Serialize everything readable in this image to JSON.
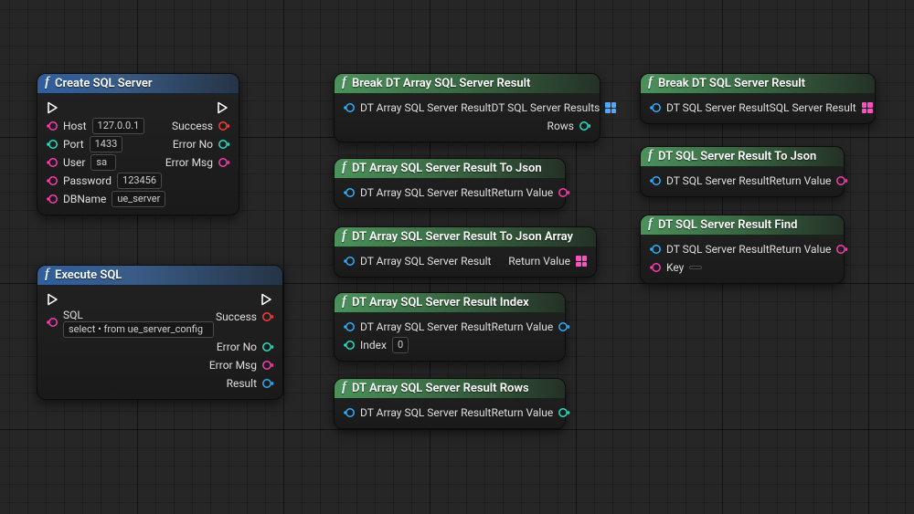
{
  "colors": {
    "exec_stroke": "#ffffff",
    "pin_host": "#ff3bb0",
    "pin_port": "#22e3c3",
    "pin_red": "#ff3b3b",
    "pin_blue": "#2bb1ff",
    "pin_array_green": "#2be38c",
    "pin_struct_blue": "#4fa8ff",
    "pin_struct_pink": "#ff4fc0"
  },
  "create": {
    "title": "Create SQL Server",
    "host_label": "Host",
    "host_value": "127.0.0.1",
    "port_label": "Port",
    "port_value": "1433",
    "user_label": "User",
    "user_value": "sa",
    "password_label": "Password",
    "password_value": "123456",
    "dbname_label": "DBName",
    "dbname_value": "ue_server",
    "success_label": "Success",
    "errno_label": "Error No",
    "errmsg_label": "Error Msg"
  },
  "exec": {
    "title": "Execute SQL",
    "sql_label": "SQL",
    "sql_value": "select • from  ue_server_config",
    "success_label": "Success",
    "errno_label": "Error No",
    "errmsg_label": "Error Msg",
    "result_label": "Result"
  },
  "break_arr": {
    "title": "Break DT Array SQL Server Result",
    "in_label": "DT Array SQL Server Result",
    "out_results": "DT SQL Server Results",
    "out_rows": "Rows"
  },
  "tojson_arr": {
    "title": "DT Array SQL Server Result To Json",
    "in_label": "DT Array SQL Server Result",
    "out_label": "Return Value"
  },
  "tojsonarr": {
    "title": "DT Array SQL Server Result To Json Array",
    "in_label": "DT Array SQL Server Result",
    "out_label": "Return Value"
  },
  "index": {
    "title": "DT Array SQL Server Result Index",
    "in_label": "DT Array SQL Server Result",
    "index_label": "Index",
    "index_value": "0",
    "out_label": "Return Value"
  },
  "rows": {
    "title": "DT Array SQL Server Result Rows",
    "in_label": "DT Array SQL Server Result",
    "out_label": "Return Value"
  },
  "break_s": {
    "title": "Break DT SQL Server Result",
    "in_label": "DT SQL Server Result",
    "out_label": "SQL Server Result"
  },
  "tojson_s": {
    "title": "DT SQL Server Result To Json",
    "in_label": "DT SQL Server Result",
    "out_label": "Return Value"
  },
  "find": {
    "title": "DT SQL Server Result Find",
    "in_label": "DT SQL Server Result",
    "key_label": "Key",
    "key_value": "",
    "out_label": "Return Value"
  }
}
